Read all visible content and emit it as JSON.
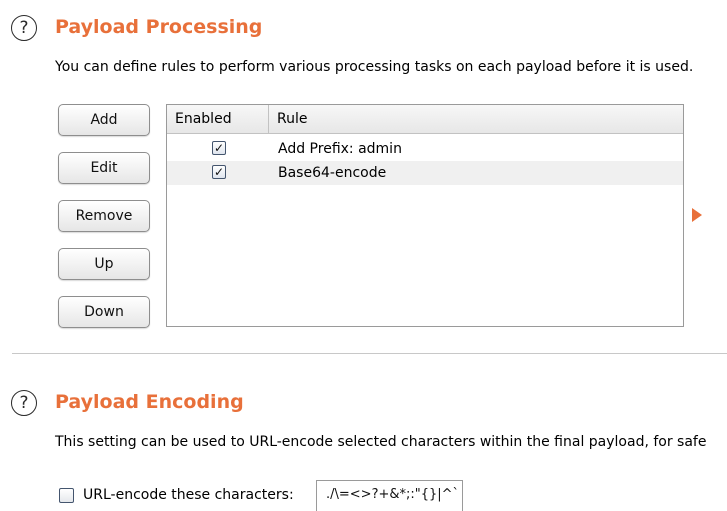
{
  "processing": {
    "title": "Payload Processing",
    "description": "You can define rules to perform various processing tasks on each payload before it is used.",
    "buttons": {
      "add": "Add",
      "edit": "Edit",
      "remove": "Remove",
      "up": "Up",
      "down": "Down"
    },
    "table": {
      "columns": [
        "Enabled",
        "Rule"
      ],
      "rows": [
        {
          "enabled": true,
          "rule": "Add Prefix: admin"
        },
        {
          "enabled": true,
          "rule": "Base64-encode"
        }
      ]
    }
  },
  "encoding": {
    "title": "Payload Encoding",
    "description": "This setting can be used to URL-encode selected characters within the final payload, for safe",
    "checkbox_label": "URL-encode these characters:",
    "checkbox_checked": false,
    "characters": "./\\=<>?+&*;:\"{}|^`"
  },
  "icons": {
    "help": "help-icon",
    "expand": "expand-arrow-icon",
    "check": "checkmark-icon"
  },
  "colors": {
    "accent": "#e8703a"
  }
}
